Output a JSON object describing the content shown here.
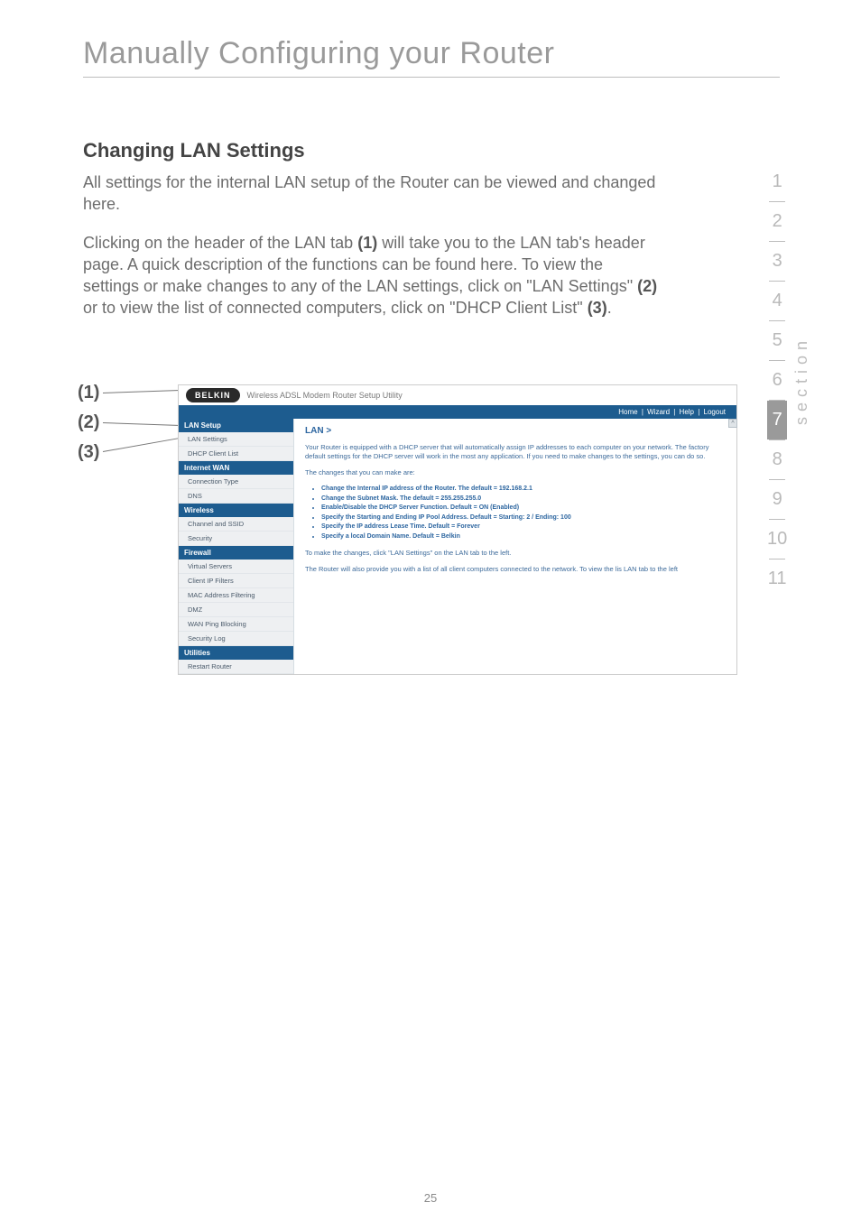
{
  "page": {
    "title": "Manually Configuring your Router",
    "section_heading": "Changing LAN Settings",
    "intro": "All settings for the internal LAN setup of the Router can be viewed and changed here.",
    "para2_a": "Clicking on the header of the LAN tab ",
    "para2_c1": "(1)",
    "para2_b": " will take you to the LAN tab's header page. A quick description of the functions can be found here. To view the settings or make changes to any of the LAN settings, click on \"LAN Settings\" ",
    "para2_c2": "(2)",
    "para2_c": " or to view the list of connected computers, click on \"DHCP Client List\" ",
    "para2_c3": "(3)",
    "para2_d": ".",
    "callouts": {
      "c1": "(1)",
      "c2": "(2)",
      "c3": "(3)"
    },
    "number": "25"
  },
  "section_strip": {
    "label": "section",
    "items": [
      "1",
      "2",
      "3",
      "4",
      "5",
      "6",
      "7",
      "8",
      "9",
      "10",
      "11"
    ],
    "active_index": 6
  },
  "shot": {
    "logo": "BELKIN",
    "app_title": "Wireless ADSL Modem Router Setup Utility",
    "nav": [
      "Home",
      "Wizard",
      "Help",
      "Logout"
    ],
    "sidebar": [
      {
        "type": "head",
        "label": "LAN Setup"
      },
      {
        "type": "item",
        "label": "LAN Settings"
      },
      {
        "type": "item",
        "label": "DHCP Client List"
      },
      {
        "type": "head",
        "label": "Internet WAN"
      },
      {
        "type": "item",
        "label": "Connection Type"
      },
      {
        "type": "item",
        "label": "DNS"
      },
      {
        "type": "head",
        "label": "Wireless"
      },
      {
        "type": "item",
        "label": "Channel and SSID"
      },
      {
        "type": "item",
        "label": "Security"
      },
      {
        "type": "head",
        "label": "Firewall"
      },
      {
        "type": "item",
        "label": "Virtual Servers"
      },
      {
        "type": "item",
        "label": "Client IP Filters"
      },
      {
        "type": "item",
        "label": "MAC Address Filtering"
      },
      {
        "type": "item",
        "label": "DMZ"
      },
      {
        "type": "item",
        "label": "WAN Ping Blocking"
      },
      {
        "type": "item",
        "label": "Security Log"
      },
      {
        "type": "head",
        "label": "Utilities"
      },
      {
        "type": "item",
        "label": "Restart Router"
      }
    ],
    "content": {
      "crumb": "LAN >",
      "p1": "Your Router is equipped with a DHCP server that will automatically assign IP addresses to each computer on your network. The factory default settings for the DHCP server will work in the most any application. If you need to make changes to the settings, you can do so.",
      "p2": "The changes that you can make are:",
      "bullets": [
        "Change the Internal IP address of the Router. The default = 192.168.2.1",
        "Change the Subnet Mask. The default = 255.255.255.0",
        "Enable/Disable the DHCP Server Function. Default = ON (Enabled)",
        "Specify the Starting and Ending IP Pool Address. Default = Starting: 2 / Ending: 100",
        "Specify the IP address Lease Time. Default = Forever",
        "Specify a local Domain Name. Default = Belkin"
      ],
      "p3": "To make the changes, click \"LAN Settings\" on the LAN tab to the left.",
      "p4": "The Router will also provide you with a list of all client computers connected to the network. To view the lis LAN tab to the left"
    }
  },
  "chart_data": null
}
